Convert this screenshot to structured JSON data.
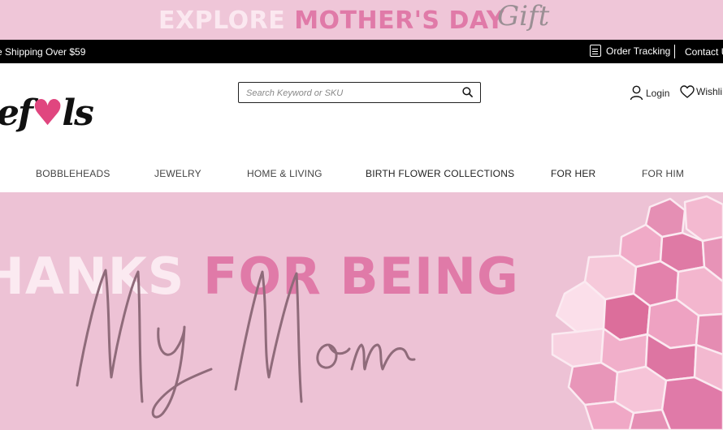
{
  "promo_banner": {
    "word1": "EXPLORE ",
    "word2": "MOTHER'S DAY",
    "script": "Gift"
  },
  "top_bar": {
    "shipping": "e Shipping Over $59",
    "order_tracking": "Order Tracking",
    "contact": "Contact U"
  },
  "header": {
    "logo": {
      "part1": "ef",
      "heart": "♥",
      "part2": "ls"
    },
    "search": {
      "placeholder": "Search Keyword or SKU",
      "value": ""
    },
    "login": "Login",
    "wishlist": "Wishli"
  },
  "nav": {
    "items": [
      "BOBBLEHEADS",
      "JEWELRY",
      "HOME & LIVING",
      "BIRTH FLOWER COLLECTIONS",
      "FOR HER",
      "FOR HIM"
    ]
  },
  "hero": {
    "line1_white": "HANKS ",
    "line1_pink": "FOR BEING",
    "script": "My Mom"
  },
  "colors": {
    "promo_bg": "#efc6d8",
    "accent_pink": "#e07aa8",
    "hero_bg": "#edc2d5",
    "topbar_bg": "#000000",
    "heart": "#e0467f"
  }
}
